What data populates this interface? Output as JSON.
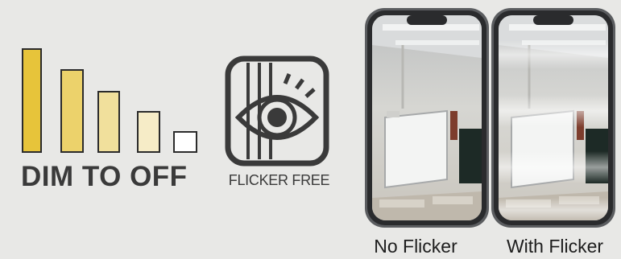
{
  "dim_badge": {
    "label": "DIM TO OFF",
    "levels": [
      1.0,
      0.74,
      0.56,
      0.38,
      0.2
    ],
    "colors": [
      "#e7c43a",
      "#ecd26b",
      "#f1e09c",
      "#f6ecc7",
      "#ffffff"
    ]
  },
  "flicker_badge": {
    "label": "FLICKER FREE",
    "icon": "eye-with-stripes-icon"
  },
  "phones": [
    {
      "caption": "No Flicker",
      "icon": "smartphone-icon"
    },
    {
      "caption": "With Flicker",
      "icon": "smartphone-icon"
    }
  ]
}
